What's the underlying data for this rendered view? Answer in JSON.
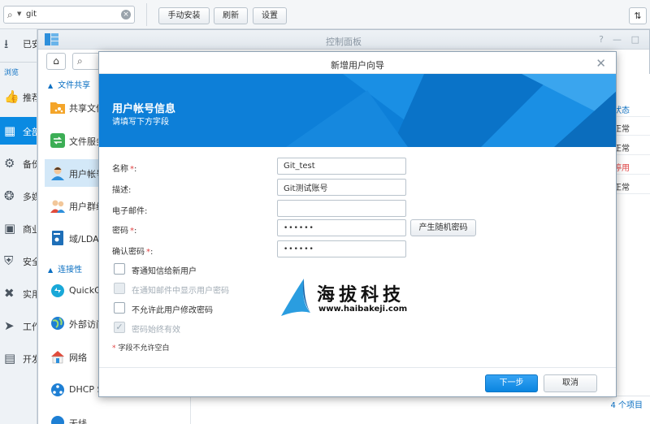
{
  "topbar": {
    "search_value": "git",
    "manual_install_label": "手动安装",
    "refresh_label": "刷新",
    "settings_label": "设置"
  },
  "package_center": {
    "installed_label": "已安",
    "browse_label": "浏览",
    "items": [
      {
        "label": "推荐",
        "icon": "thumbs-up-icon"
      },
      {
        "label": "全部",
        "icon": "grid-icon"
      },
      {
        "label": "备份",
        "icon": "backup-icon"
      },
      {
        "label": "多媒",
        "icon": "film-reel-icon"
      },
      {
        "label": "商业",
        "icon": "briefcase-icon"
      },
      {
        "label": "安全",
        "icon": "shield-icon"
      },
      {
        "label": "实用",
        "icon": "tools-icon"
      },
      {
        "label": "工作",
        "icon": "rocket-icon"
      },
      {
        "label": "开发",
        "icon": "dev-icon"
      }
    ]
  },
  "control_panel": {
    "title": "控制面板",
    "group_file_sharing": "文件共享",
    "group_connectivity": "连接性",
    "items": [
      {
        "label": "共享文件夹",
        "icon": "shared-folder-icon"
      },
      {
        "label": "文件服务",
        "icon": "file-services-icon"
      },
      {
        "label": "用户帐号",
        "icon": "user-icon"
      },
      {
        "label": "用户群组",
        "icon": "group-icon"
      },
      {
        "label": "域/LDAP",
        "icon": "domain-icon"
      },
      {
        "label": "QuickConnect",
        "icon": "quickconnect-icon"
      },
      {
        "label": "外部访问",
        "icon": "globe-icon"
      },
      {
        "label": "网络",
        "icon": "network-home-icon"
      },
      {
        "label": "DHCP Server",
        "icon": "dhcp-icon"
      },
      {
        "label": "无线",
        "icon": "wireless-icon"
      }
    ],
    "status_header": "状态",
    "row_statuses": [
      {
        "text": "正常",
        "color": "#333333"
      },
      {
        "text": "正常",
        "color": "#333333"
      },
      {
        "text": "停用",
        "color": "#e04343"
      },
      {
        "text": "正常",
        "color": "#333333"
      }
    ],
    "item_count": "4 个项目"
  },
  "wizard": {
    "title": "新增用户向导",
    "heading": "用户帐号信息",
    "subheading": "请填写下方字段",
    "name_label": "名称",
    "name_value": "Git_test",
    "desc_label": "描述:",
    "desc_value": "Git测试账号",
    "email_label": "电子邮件:",
    "email_value": "",
    "password_label": "密码",
    "password_value": "••••••",
    "confirm_label": "确认密码",
    "confirm_value": "••••••",
    "required_mark": "*",
    "generate_password_label": "产生随机密码",
    "checkboxes": [
      {
        "label": "寄通知信给新用户",
        "checked": false,
        "disabled": false
      },
      {
        "label": "在通知邮件中显示用户密码",
        "checked": false,
        "disabled": true
      },
      {
        "label": "不允许此用户修改密码",
        "checked": false,
        "disabled": false
      },
      {
        "label": "密码始终有效",
        "checked": true,
        "disabled": true
      }
    ],
    "required_note": "字段不允许空白",
    "next_label": "下一步",
    "cancel_label": "取消"
  },
  "watermark": {
    "text_cn": "海拔科技",
    "url": "www.haibakeji.com"
  },
  "colors": {
    "accent": "#0a8ae2",
    "banner": "#0d7fd8",
    "required": "#e04343"
  }
}
